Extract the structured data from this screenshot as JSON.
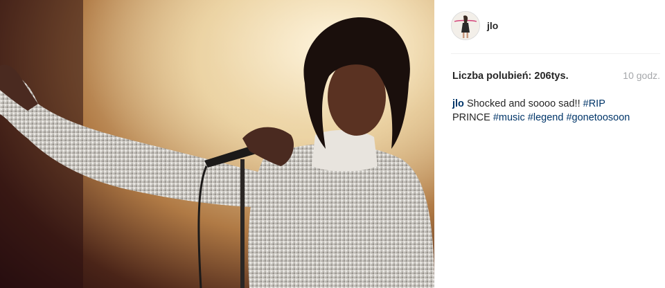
{
  "post": {
    "username": "jlo",
    "likes_label": "Liczba polubień: 206tys.",
    "time_ago": "10 godz.",
    "caption": {
      "author": "jlo",
      "text_1": " Shocked and soooo sad!! ",
      "tag_1": "#RIP",
      "text_2": "PRINCE ",
      "tag_2": "#music",
      "tag_3": "#legend",
      "tag_4": "#gonetoosoon"
    }
  },
  "colors": {
    "link": "#003569",
    "text": "#262626",
    "muted": "#a5a7aa",
    "divider": "#efefef"
  }
}
